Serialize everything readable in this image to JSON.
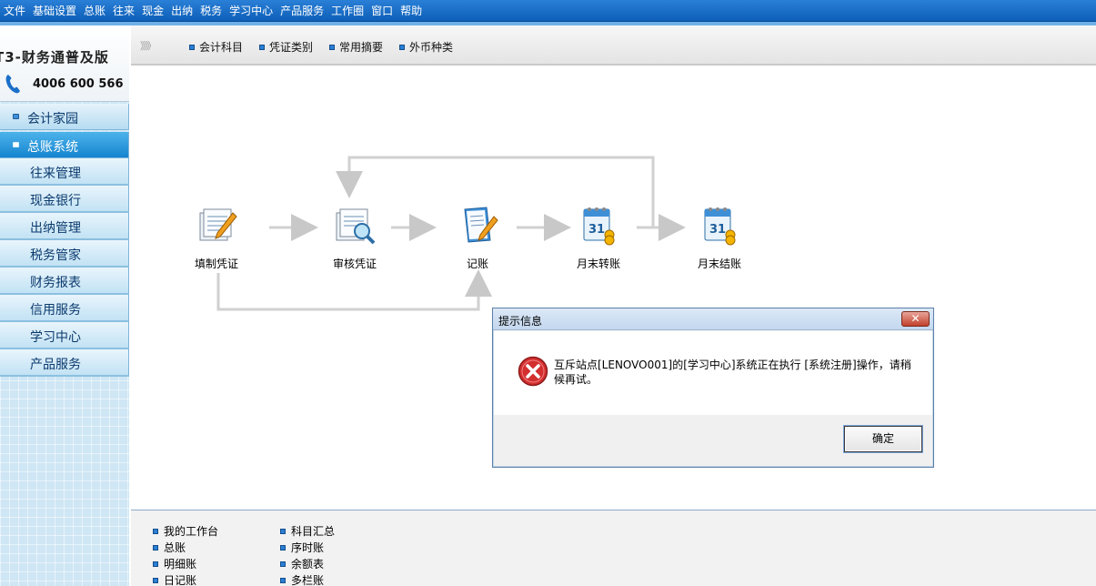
{
  "menubar": {
    "items": [
      "文件",
      "基础设置",
      "总账",
      "往来",
      "现金",
      "出纳",
      "税务",
      "学习中心",
      "产品服务",
      "工作圈",
      "窗口",
      "帮助"
    ]
  },
  "brand": {
    "title": "T3-财务通普及版",
    "phone": "4006 600 566"
  },
  "sidebar": {
    "sections": [
      {
        "label": "会计家园",
        "active": false
      },
      {
        "label": "总账系统",
        "active": true
      }
    ],
    "items": [
      "往来管理",
      "现金银行",
      "出纳管理",
      "税务管家",
      "财务报表",
      "信用服务",
      "学习中心",
      "产品服务"
    ]
  },
  "toolbar": {
    "chevron": "》》》",
    "items": [
      "会计科目",
      "凭证类别",
      "常用摘要",
      "外币种类"
    ]
  },
  "flow": {
    "nodes": [
      {
        "label": "填制凭证",
        "icon": "voucher-entry-icon"
      },
      {
        "label": "审核凭证",
        "icon": "voucher-audit-icon"
      },
      {
        "label": "记账",
        "icon": "posting-icon"
      },
      {
        "label": "月末转账",
        "icon": "month-end-transfer-icon"
      },
      {
        "label": "月末结账",
        "icon": "month-end-close-icon"
      }
    ]
  },
  "bottom": {
    "col1": [
      "我的工作台",
      "总账",
      "明细账",
      "日记账"
    ],
    "col2": [
      "科目汇总",
      "序时账",
      "余额表",
      "多栏账"
    ]
  },
  "dialog": {
    "title": "提示信息",
    "close": "✕",
    "message": "互斥站点[LENOVO001]的[学习中心]系统正在执行 [系统注册]操作，请稍候再试。",
    "ok": "确定"
  },
  "colors": {
    "menubar": "#1a6fc9",
    "sidebar_active": "#1584cf",
    "arrow": "#c8c8c8",
    "error_red": "#c62828"
  }
}
